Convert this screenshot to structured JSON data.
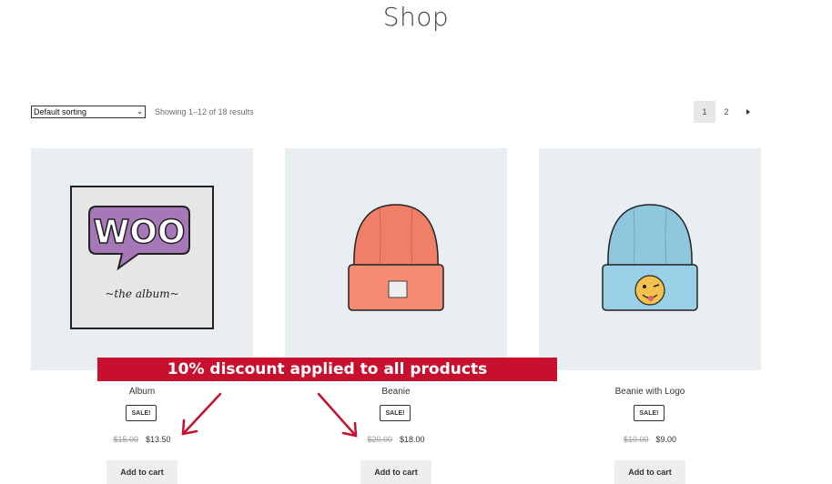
{
  "page": {
    "title": "Shop"
  },
  "toolbar": {
    "sort_selected": "Default sorting",
    "result_count": "Showing 1–12 of 18 results",
    "pages": [
      "1",
      "2"
    ],
    "next_icon": "chevron-right-icon"
  },
  "banner": {
    "text": "10% discount applied to all products",
    "color": "#c8102e"
  },
  "products": [
    {
      "name": "Album",
      "badge": "SALE!",
      "old_price": "$15.00",
      "new_price": "$13.50",
      "button": "Add to cart"
    },
    {
      "name": "Beanie",
      "badge": "SALE!",
      "old_price": "$20.00",
      "new_price": "$18.00",
      "button": "Add to cart"
    },
    {
      "name": "Beanie with Logo",
      "badge": "SALE!",
      "old_price": "$10.00",
      "new_price": "$9.00",
      "button": "Add to cart"
    }
  ],
  "colors": {
    "image_bg": "#e8eef2",
    "arrow": "#c8102e"
  }
}
